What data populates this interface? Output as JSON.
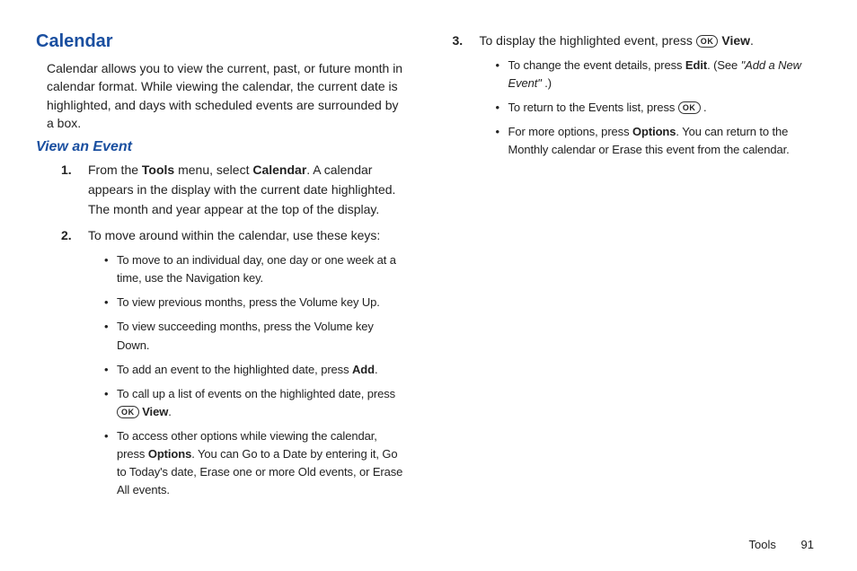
{
  "heading": "Calendar",
  "intro": "Calendar allows you to view the current, past, or future month in calendar format. While viewing the calendar, the current date is highlighted, and days with scheduled events are surrounded by a box.",
  "subheading": "View an Event",
  "step1": {
    "num": "1.",
    "p1": "From the ",
    "b1": "Tools",
    "p2": " menu, select ",
    "b2": "Calendar",
    "p3": ". A calendar appears in the display with the current date highlighted. The month and year appear at the top of the display."
  },
  "step2": {
    "num": "2.",
    "text": "To move around within the calendar, use these keys:",
    "bullets": {
      "b1": "To move to an individual day, one day or one week at a time, use the Navigation key.",
      "b2": "To view previous months, press the Volume key Up.",
      "b3": "To view succeeding months, press the Volume key Down.",
      "b4_pre": "To add an event to the highlighted date, press ",
      "b4_bold": "Add",
      "b4_post": ".",
      "b5_pre": "To call up a list of events on the highlighted date, press ",
      "b5_bold": "View",
      "b5_post": ".",
      "b6_pre": "To access other options while viewing the calendar, press ",
      "b6_bold": "Options",
      "b6_post": ". You can Go to a Date by entering it, Go to Today's date, Erase one or more Old events, or Erase All events."
    }
  },
  "step3": {
    "num": "3.",
    "p1": "To display the highlighted event, press ",
    "b1": "View",
    "p2": ".",
    "bullets": {
      "b1_pre": "To change the event details, press ",
      "b1_bold": "Edit",
      "b1_mid": ". (See ",
      "b1_ital": "\"Add a New Event\"",
      "b1_post": " .)",
      "b2_pre": "To return to the Events list, press ",
      "b2_post": " .",
      "b3_pre": "For more options, press ",
      "b3_bold": "Options",
      "b3_post": ". You can return to the Monthly calendar or Erase this event from the calendar."
    }
  },
  "ok_label": "OK",
  "footer_section": "Tools",
  "footer_page": "91"
}
